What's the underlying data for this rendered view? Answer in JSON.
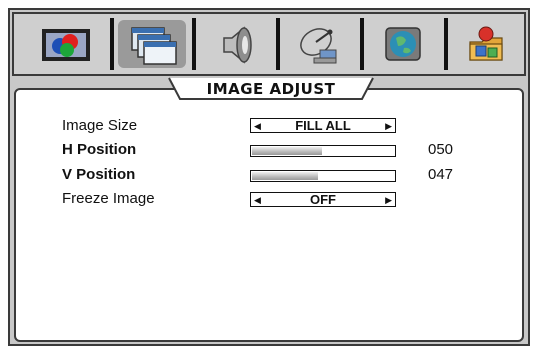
{
  "menu": {
    "title": "IMAGE ADJUST",
    "tabs": [
      {
        "icon": "color-picture-icon",
        "active": false
      },
      {
        "icon": "image-adjust-windows-icon",
        "active": true
      },
      {
        "icon": "speaker-audio-icon",
        "active": false
      },
      {
        "icon": "satellite-dish-icon",
        "active": false
      },
      {
        "icon": "globe-icon",
        "active": false
      },
      {
        "icon": "user-folder-icon",
        "active": false
      }
    ]
  },
  "rows": {
    "image_size": {
      "label": "Image Size",
      "value": "FILL ALL"
    },
    "h_position": {
      "label": "H Position",
      "value": "050",
      "level": 0.5
    },
    "v_position": {
      "label": "V Position",
      "value": "047",
      "level": 0.47
    },
    "freeze_image": {
      "label": "Freeze Image",
      "value": "OFF"
    }
  },
  "colors": {
    "frame": "#3a3a3a",
    "background": "#c8c8c8",
    "active_tab": "#9a9a9a",
    "panel": "#ffffff"
  }
}
